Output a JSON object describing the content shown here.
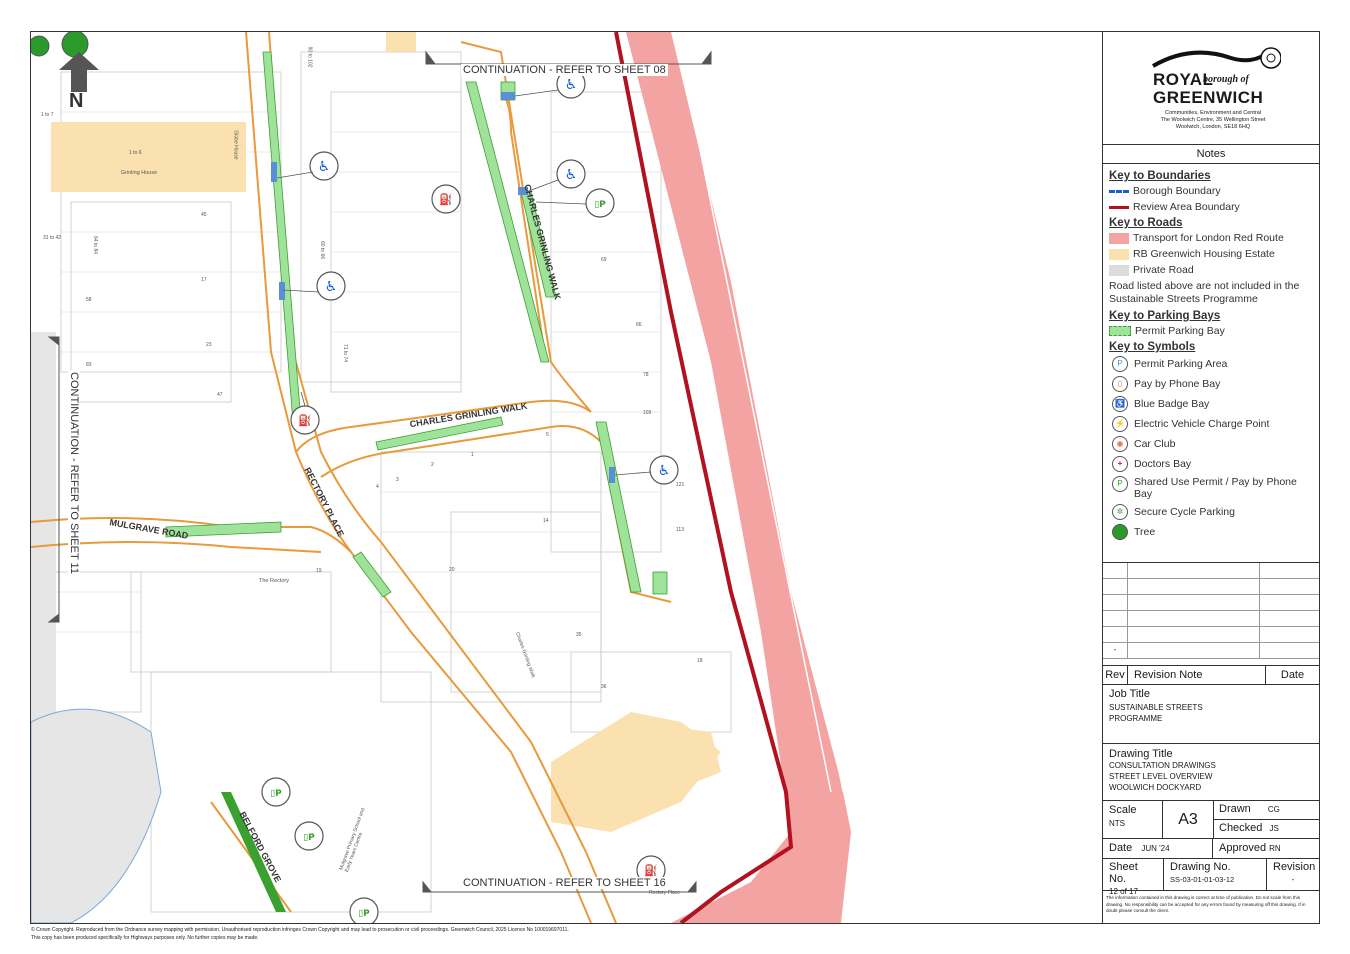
{
  "map": {
    "north_label": "N",
    "continuation_top": "CONTINUATION - REFER TO SHEET 08",
    "continuation_bottom": "CONTINUATION - REFER TO SHEET 16",
    "continuation_left": "CONTINUATION - REFER TO SHEET 11",
    "roads": [
      "CHARLES GRINLING WALK",
      "CHARLES GRINLING WALK",
      "RECTORY PLACE",
      "MULGRAVE ROAD",
      "BELFORD GROVE"
    ],
    "building_labels": [
      "Grinling House",
      "The Rectory",
      "Mulgrave Primary School and Early Years Centre",
      "Charles Grinling Walk",
      "Globe House",
      "Rectory Place"
    ],
    "house_numbers": [
      "1 to 6",
      "1 to 7",
      "31 to 42",
      "64 to 84",
      "90 to 102",
      "60 to 66",
      "71 to 74",
      "45",
      "58",
      "17",
      "23",
      "47",
      "83",
      "69",
      "66",
      "78",
      "109",
      "113",
      "121",
      "1",
      "2",
      "3",
      "4",
      "5",
      "14",
      "19",
      "20",
      "35",
      "36",
      "18"
    ]
  },
  "logo": {
    "line1": "ROYAL",
    "borough": "borough of",
    "line2": "GREENWICH",
    "address": [
      "Communities, Environment and Central",
      "The Woolwich Centre, 35 Wellington Street",
      "Woolwich, London, SE18 6HQ"
    ]
  },
  "notes_title": "Notes",
  "keys": {
    "boundaries_title": "Key to Boundaries",
    "boundaries": [
      {
        "label": "Borough Boundary",
        "color": "#1a5fd1"
      },
      {
        "label": "Review Area Boundary",
        "color": "#b21220"
      }
    ],
    "roads_title": "Key to Roads",
    "roads": [
      {
        "label": "Transport for London Red Route",
        "color": "#f4a3a3"
      },
      {
        "label": "RB Greenwich Housing Estate",
        "color": "#fbe0b0"
      },
      {
        "label": "Private Road",
        "color": "#dcdcdc"
      }
    ],
    "roads_note": "Road listed above are not included in the Sustainable Streets Programme",
    "parking_title": "Key to Parking Bays",
    "parking": [
      {
        "label": "Permit Parking Bay",
        "color": "#9fe39a"
      }
    ],
    "symbols_title": "Key to Symbols",
    "symbols": [
      {
        "label": "Permit Parking Area",
        "icon": "permit-parking-area-icon",
        "color": "#3aa0d8"
      },
      {
        "label": "Pay by Phone Bay",
        "icon": "pay-by-phone-icon",
        "color": "#e08a1e"
      },
      {
        "label": "Blue Badge Bay",
        "icon": "blue-badge-icon",
        "color": "#1a5fd1"
      },
      {
        "label": "Electric Vehicle Charge Point",
        "icon": "ev-charge-icon",
        "color": "#19a090"
      },
      {
        "label": "Car Club",
        "icon": "car-club-icon",
        "color": "#e07040"
      },
      {
        "label": "Doctors Bay",
        "icon": "doctors-bay-icon",
        "color": "#d01818"
      },
      {
        "label": "Shared Use Permit / Pay by Phone Bay",
        "icon": "shared-use-icon",
        "color": "#3aa030"
      },
      {
        "label": "Secure Cycle Parking",
        "icon": "cycle-parking-icon",
        "color": "#3aa030"
      },
      {
        "label": "Tree",
        "icon": "tree-icon",
        "color": "#2a9a2a"
      }
    ]
  },
  "revision": {
    "rev": "Rev",
    "note": "Revision Note",
    "date": "Date",
    "dash": "-"
  },
  "job": {
    "label": "Job Title",
    "value": "SUSTAINABLE STREETS PROGRAMME"
  },
  "drawing": {
    "label": "Drawing Title",
    "lines": [
      "CONSULTATION DRAWINGS",
      "STREET LEVEL OVERVIEW",
      "WOOLWICH DOCKYARD"
    ]
  },
  "scale": {
    "label": "Scale",
    "value": "NTS",
    "paper": "A3"
  },
  "drawn": {
    "label": "Drawn",
    "value": "CG"
  },
  "checked": {
    "label": "Checked",
    "value": "JS"
  },
  "date": {
    "label": "Date",
    "value": "JUN '24"
  },
  "approved": {
    "label": "Approved",
    "value": "RN"
  },
  "sheet": {
    "label": "Sheet No.",
    "value": "12 of 17"
  },
  "drawing_no": {
    "label": "Drawing No.",
    "value": "SS-03-01-01-03-12"
  },
  "revision_col": {
    "label": "Revision",
    "value": "-"
  },
  "disclaimer": "The information contained in this drawing is correct at time of publication. Do not scale from this drawing. No responsibility can be accepted for any errors found by measuring off this drawing. If in doubt please consult the client.",
  "copyright": [
    "© Crown Copyright. Reproduced from the Ordnance survey mapping with permission. Unauthorised reproduction infringes Crown Copyright and may lead to prosecution or civil proceedings. Greenwich Council, 2025 Licence No 100019697011.",
    "This copy has been produced specifically for Highways purposes only. No further copies may be made."
  ]
}
